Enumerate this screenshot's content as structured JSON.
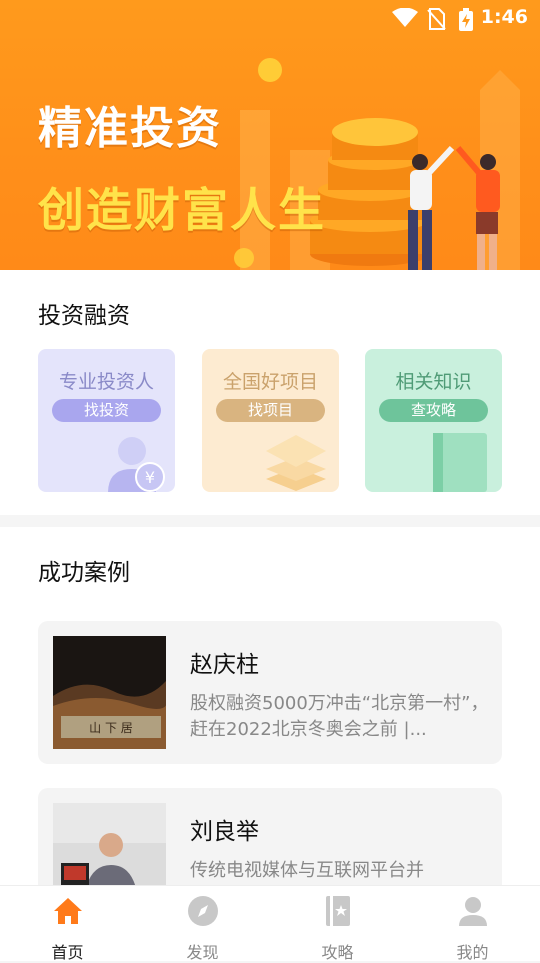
{
  "status_bar": {
    "time": "1:46"
  },
  "banner": {
    "line1": "精准投资",
    "line2": "创造财富人生"
  },
  "invest_section": {
    "title": "投资融资",
    "cards": [
      {
        "title": "专业投资人",
        "button": "找投资"
      },
      {
        "title": "全国好项目",
        "button": "找项目"
      },
      {
        "title": "相关知识",
        "button": "查攻略"
      }
    ]
  },
  "cases_section": {
    "title": "成功案例",
    "items": [
      {
        "name": "赵庆柱",
        "desc": "股权融资5000万冲击“北京第一村”，赶在2022北京冬奥会之前 |..."
      },
      {
        "name": "刘良举",
        "desc": "传统电视媒体与互联网平台并"
      }
    ],
    "thumb_sign_text": "山 下 居"
  },
  "tabbar": {
    "items": [
      {
        "label": "首页",
        "icon": "home-icon",
        "active": true
      },
      {
        "label": "发现",
        "icon": "compass-icon",
        "active": false
      },
      {
        "label": "攻略",
        "icon": "guide-book-icon",
        "active": false
      },
      {
        "label": "我的",
        "icon": "person-icon",
        "active": false
      }
    ],
    "active_color": "#ff7a1a",
    "inactive_color": "#c8c8c8"
  }
}
